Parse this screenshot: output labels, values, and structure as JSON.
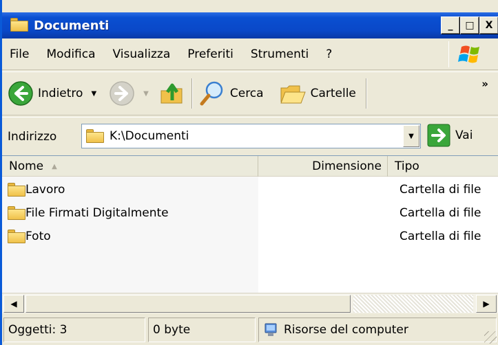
{
  "window": {
    "title": "Documenti",
    "controls": [
      "_",
      "□",
      "X"
    ]
  },
  "menu": {
    "items": [
      "File",
      "Modifica",
      "Visualizza",
      "Preferiti",
      "Strumenti",
      "?"
    ]
  },
  "toolbar": {
    "back_label": "Indietro",
    "search_label": "Cerca",
    "folders_label": "Cartelle",
    "more": "»"
  },
  "address": {
    "label": "Indirizzo",
    "value": "K:\\Documenti",
    "go_label": "Vai"
  },
  "list": {
    "columns": [
      "Nome",
      "Dimensione",
      "Tipo"
    ],
    "rows": [
      {
        "name": "Lavoro",
        "type": "Cartella di file"
      },
      {
        "name": "File Firmati Digitalmente",
        "type": "Cartella di file"
      },
      {
        "name": "Foto",
        "type": "Cartella di file"
      }
    ]
  },
  "status": {
    "objects": "Oggetti: 3",
    "size": "0 byte",
    "location": "Risorse del computer"
  },
  "colors": {
    "titlebar": "#0a4fd1",
    "chrome": "#ece9d8",
    "folder": "#f0c14a"
  }
}
